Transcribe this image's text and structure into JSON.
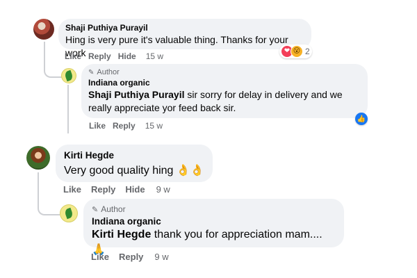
{
  "comments": [
    {
      "author": "Shaji Puthiya Purayil",
      "text": "Hing is very pure it's valuable thing. Thanks for your work",
      "actions": [
        "Like",
        "Reply",
        "Hide"
      ],
      "time": "15 w",
      "reactions": {
        "icons": [
          "heart-icon",
          "wow-icon"
        ],
        "count": "2"
      },
      "reply": {
        "author_badge": "Author",
        "author": "Indiana organic",
        "mention": "Shaji Puthiya Purayil",
        "text": " sir sorry for delay in delivery and we really appreciate yor feed back sir.",
        "actions": [
          "Like",
          "Reply"
        ],
        "time": "15 w",
        "reactions": {
          "icons": [
            "like-icon"
          ]
        }
      }
    },
    {
      "author": "Kirti Hegde",
      "text": "Very good quality hing",
      "text_emoji": "👌👌",
      "actions": [
        "Like",
        "Reply",
        "Hide"
      ],
      "time": "9 w",
      "reply": {
        "author_badge": "Author",
        "author": "Indiana organic",
        "mention": "Kirti Hegde",
        "text": " thank you for appreciation mam....",
        "text_emoji": "🙏",
        "actions": [
          "Like",
          "Reply"
        ],
        "time": "9 w"
      }
    }
  ],
  "colors": {
    "bubble": "#f0f2f5",
    "secondary_text": "#65676b",
    "thread_line": "#ced0d4",
    "like_blue": "#1877f2",
    "heart_red": "#f33e58",
    "wow_yellow": "#f7b125"
  }
}
